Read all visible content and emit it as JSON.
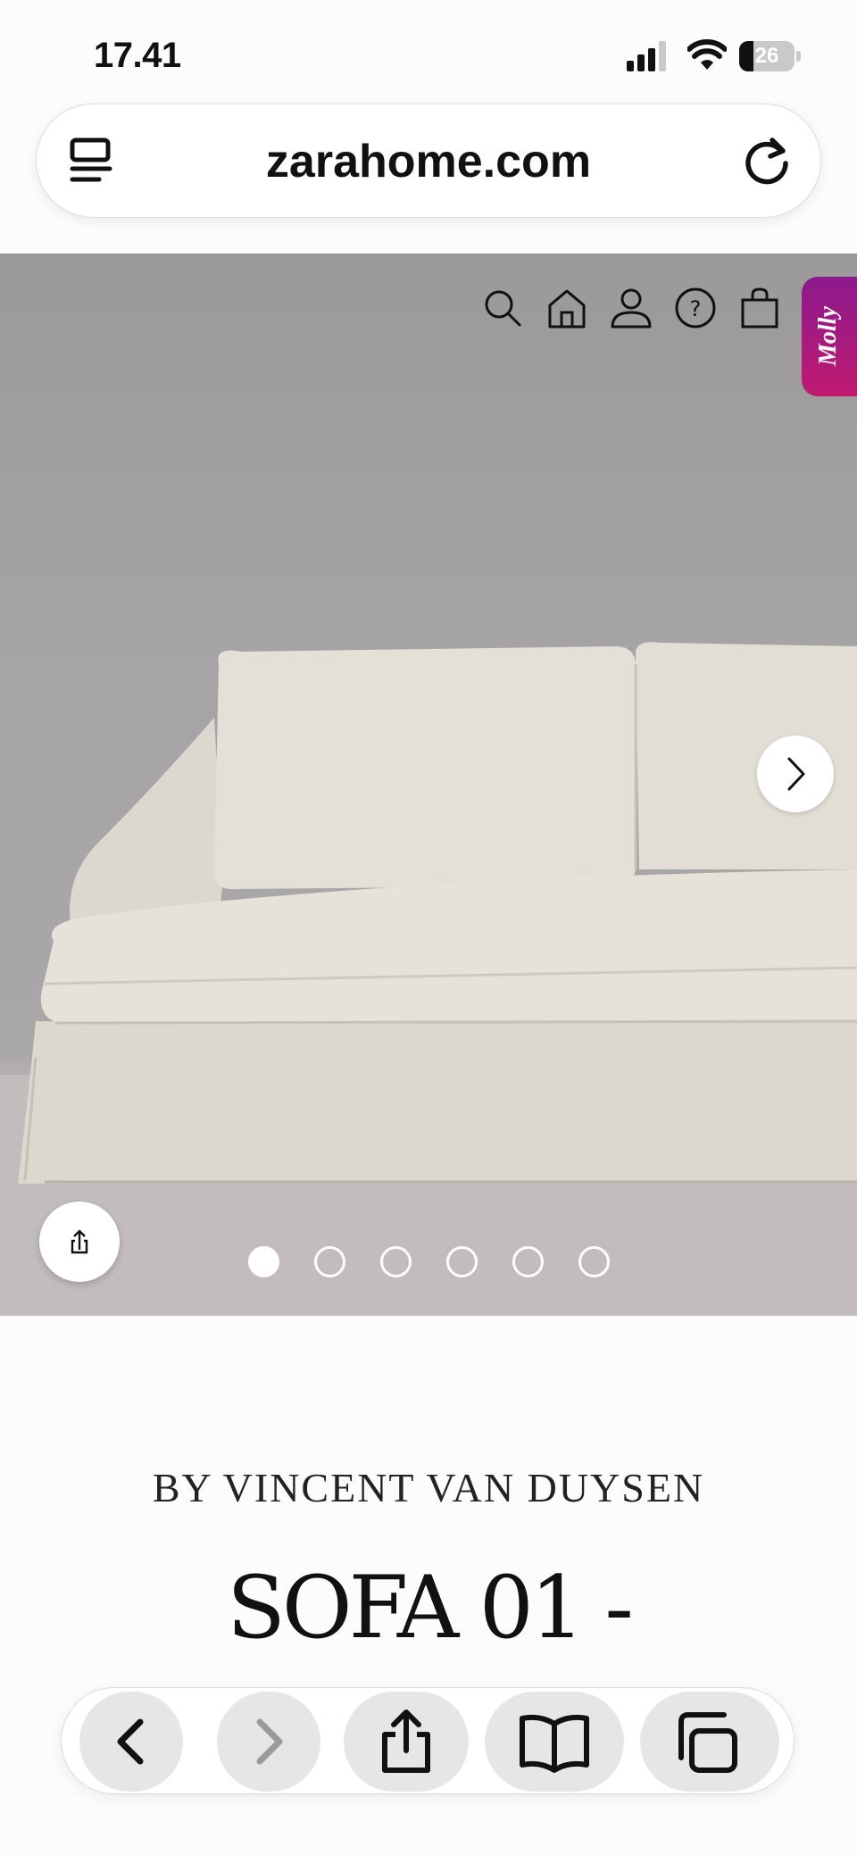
{
  "status_bar": {
    "time": "17.41",
    "battery_level": "26",
    "battery_fraction": 0.26
  },
  "browser": {
    "url": "zarahome.com"
  },
  "site_nav": {
    "icons": [
      "search-icon",
      "home-icon",
      "account-icon",
      "help-icon",
      "shopping-bag-icon"
    ]
  },
  "chat_widget": {
    "label": "Molly",
    "gradient": [
      "#8c1a8e",
      "#c01a6f"
    ]
  },
  "carousel": {
    "slide_count": 6,
    "active_index": 0
  },
  "product": {
    "brand_line": "BY VINCENT VAN DUYSEN",
    "title": "SOFA 01 -"
  },
  "toolbar": {
    "icons": [
      "back-icon",
      "forward-icon",
      "share-icon",
      "bookmarks-icon",
      "tabs-icon"
    ]
  }
}
